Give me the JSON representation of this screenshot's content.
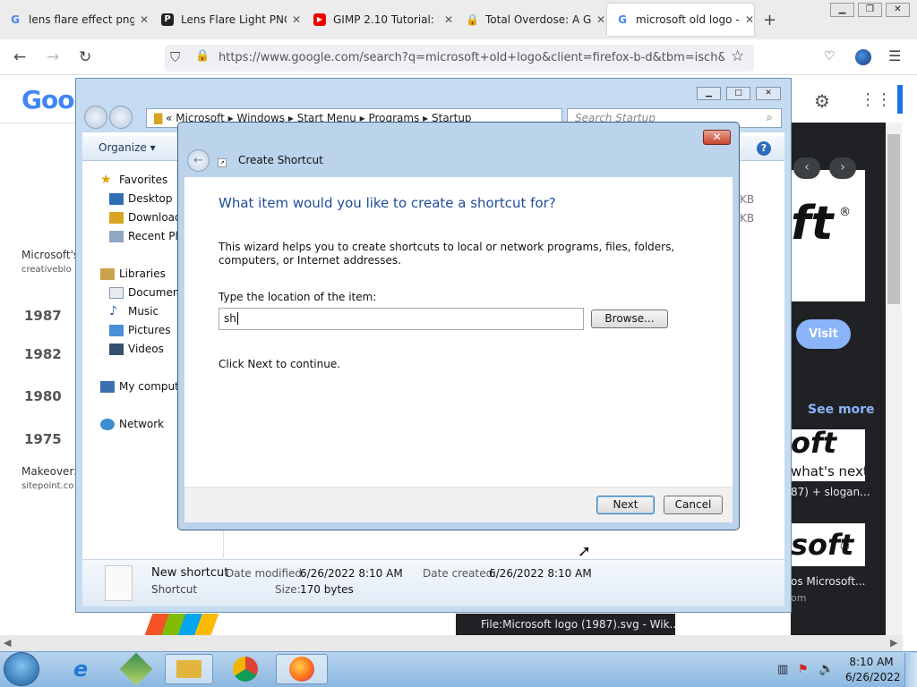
{
  "browser": {
    "tabs": [
      {
        "label": "lens flare effect png -",
        "icon": "google-icon"
      },
      {
        "label": "Lens Flare Light PNG",
        "icon": "p-icon"
      },
      {
        "label": "GIMP 2.10 Tutorial: M",
        "icon": "youtube-icon"
      },
      {
        "label": "Total Overdose: A Gu",
        "icon": "lock-icon"
      },
      {
        "label": "microsoft old logo -",
        "icon": "google-icon"
      }
    ],
    "url": "https://www.google.com/search?q=microsoft+old+logo&client=firefox-b-d&tbm=isch&sou"
  },
  "google": {
    "logo": "Goog",
    "result_title": "Microsoft's",
    "result_source": "creativeblo",
    "years": [
      "1987",
      "1982",
      "1980",
      "1975"
    ],
    "makeover": "Makeover:",
    "makeover_source": "sitepoint.co",
    "visit": "Visit",
    "see_more": "See more",
    "logo_text_1": "ft",
    "logo_text_2": "oft",
    "whats_next": "what's next.",
    "caption_1": "87) + slogan...",
    "logo_text_3": "soft",
    "caption_2": "os Microsoft...",
    "caption_3": "om",
    "bottom_result": "File:Microsoft logo (1987).svg - Wik..."
  },
  "explorer": {
    "breadcrumb": [
      "Microsoft",
      "Windows",
      "Start Menu",
      "Programs",
      "Startup"
    ],
    "search_placeholder": "Search Startup",
    "organize": "Organize",
    "nav": {
      "favorites": "Favorites",
      "desktop": "Desktop",
      "downloads": "Downloads",
      "recent": "Recent Pla",
      "libraries": "Libraries",
      "documents": "Document",
      "music": "Music",
      "pictures": "Pictures",
      "videos": "Videos",
      "computer": "My compute",
      "network": "Network"
    },
    "size_col": [
      "KB",
      "KB"
    ],
    "details": {
      "name": "New shortcut",
      "type": "Shortcut",
      "modified_label": "Date modified:",
      "modified": "6/26/2022 8:10 AM",
      "created_label": "Date created:",
      "created": "6/26/2022 8:10 AM",
      "size_label": "Size:",
      "size": "170 bytes"
    }
  },
  "dialog": {
    "title": "Create Shortcut",
    "heading": "What item would you like to create a shortcut for?",
    "description": "This wizard helps you to create shortcuts to local or network programs, files, folders, computers, or Internet addresses.",
    "location_label": "Type the location of the item:",
    "location_value": "sh",
    "browse": "Browse...",
    "continue_text": "Click Next to continue.",
    "next": "Next",
    "cancel": "Cancel"
  },
  "taskbar": {
    "time": "8:10 AM",
    "date": "6/26/2022"
  }
}
